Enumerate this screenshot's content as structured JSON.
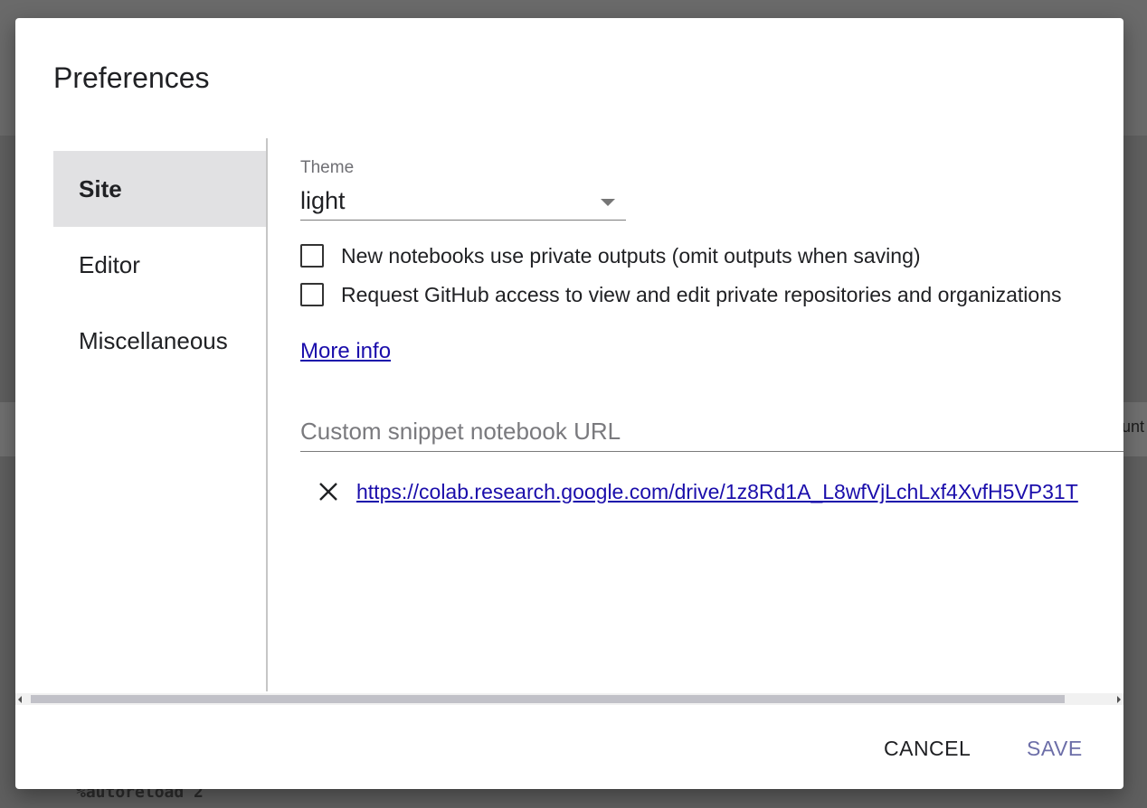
{
  "background": {
    "edge_text": "unt",
    "code_text": "%autoreload 2"
  },
  "dialog": {
    "title": "Preferences",
    "sidebar": {
      "items": [
        {
          "label": "Site",
          "active": true
        },
        {
          "label": "Editor",
          "active": false
        },
        {
          "label": "Miscellaneous",
          "active": false
        }
      ]
    },
    "site": {
      "theme": {
        "label": "Theme",
        "value": "light"
      },
      "checkboxes": [
        {
          "label": "New notebooks use private outputs (omit outputs when saving)",
          "checked": false
        },
        {
          "label": "Request GitHub access to view and edit private repositories and organizations",
          "checked": false
        }
      ],
      "more_info": "More info",
      "custom_snippet": {
        "placeholder": "Custom snippet notebook URL",
        "value": ""
      },
      "snippet_urls": [
        "https://colab.research.google.com/drive/1z8Rd1A_L8wfVjLchLxf4XvfH5VP31T"
      ]
    },
    "scrollbar": {
      "horizontal_thumb_fraction": 0.96
    },
    "buttons": {
      "cancel": "CANCEL",
      "save": "SAVE"
    }
  },
  "icons": {
    "remove_snippet": "close-icon",
    "theme_dropdown": "dropdown-arrow-icon"
  },
  "colors": {
    "link": "#1a0dab",
    "save_button": "#6c6ea8",
    "active_nav_bg": "#e1e1e3"
  }
}
